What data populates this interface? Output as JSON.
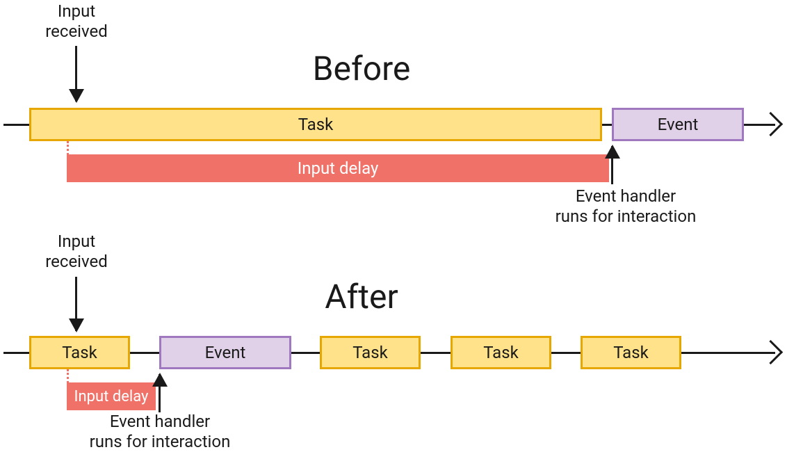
{
  "before": {
    "title": "Before",
    "input_label": "Input\nreceived",
    "task_label": "Task",
    "event_label": "Event",
    "delay_label": "Input delay",
    "handler_label": "Event handler\nruns for interaction"
  },
  "after": {
    "title": "After",
    "input_label": "Input\nreceived",
    "tasks": [
      "Task",
      "Task",
      "Task",
      "Task"
    ],
    "event_label": "Event",
    "delay_label": "Input delay",
    "handler_label": "Event handler\nruns for interaction"
  },
  "colors": {
    "task_fill": "#ffe28a",
    "task_border": "#e6a800",
    "event_fill": "#e0d1e8",
    "event_border": "#a078c0",
    "delay": "#ef7168",
    "ink": "#1a1a1a"
  }
}
